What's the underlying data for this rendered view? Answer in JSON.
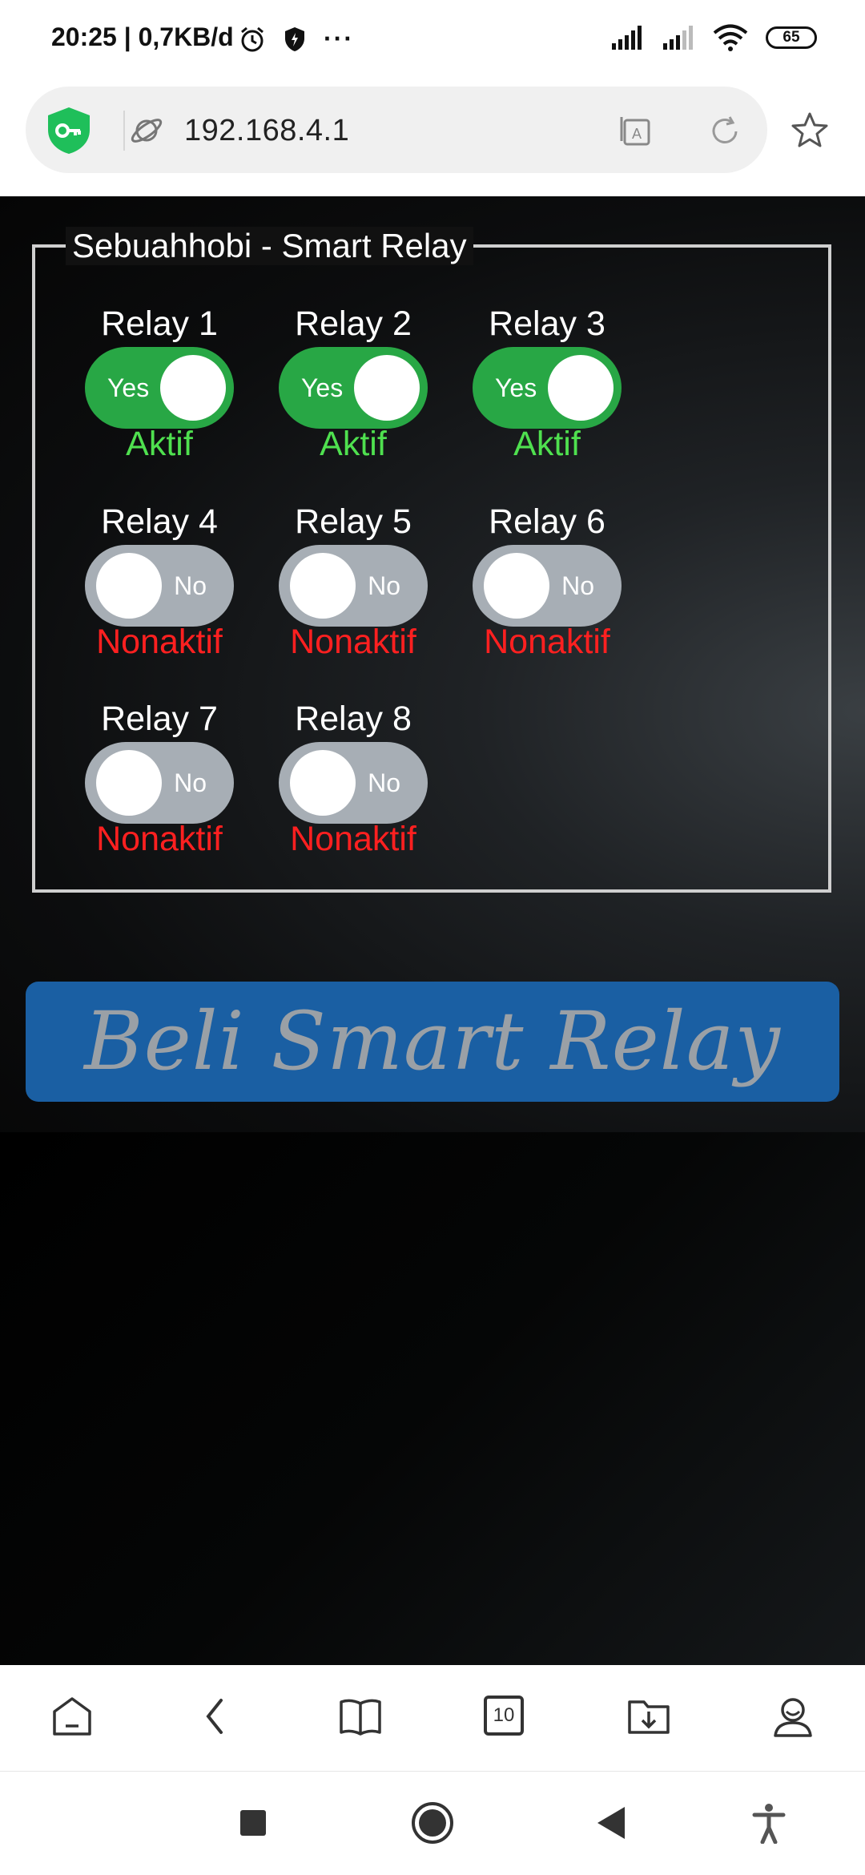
{
  "status_bar": {
    "time": "20:25 | 0,7KB/d",
    "more": "···",
    "battery": "65"
  },
  "browser": {
    "url": "192.168.4.1"
  },
  "page": {
    "legend": "Sebuahhobi - Smart Relay",
    "relays": [
      {
        "label": "Relay 1",
        "toggle_text": "Yes",
        "state": "Aktif",
        "on": true
      },
      {
        "label": "Relay 2",
        "toggle_text": "Yes",
        "state": "Aktif",
        "on": true
      },
      {
        "label": "Relay 3",
        "toggle_text": "Yes",
        "state": "Aktif",
        "on": true
      },
      {
        "label": "Relay 4",
        "toggle_text": "No",
        "state": "Nonaktif",
        "on": false
      },
      {
        "label": "Relay 5",
        "toggle_text": "No",
        "state": "Nonaktif",
        "on": false
      },
      {
        "label": "Relay 6",
        "toggle_text": "No",
        "state": "Nonaktif",
        "on": false
      },
      {
        "label": "Relay 7",
        "toggle_text": "No",
        "state": "Nonaktif",
        "on": false
      },
      {
        "label": "Relay 8",
        "toggle_text": "No",
        "state": "Nonaktif",
        "on": false
      }
    ],
    "buy_button": "Beli Smart Relay"
  },
  "toolbar": {
    "tabs_count": "10",
    "icons": [
      "home-icon",
      "back-icon",
      "book-icon",
      "tabs-icon",
      "download-folder-icon",
      "profile-icon"
    ]
  },
  "colors": {
    "on": "#28a745",
    "off": "#a7aeb5",
    "active_text": "#4fe04f",
    "inactive_text": "#ff2020",
    "button": "#1a5fa3"
  }
}
